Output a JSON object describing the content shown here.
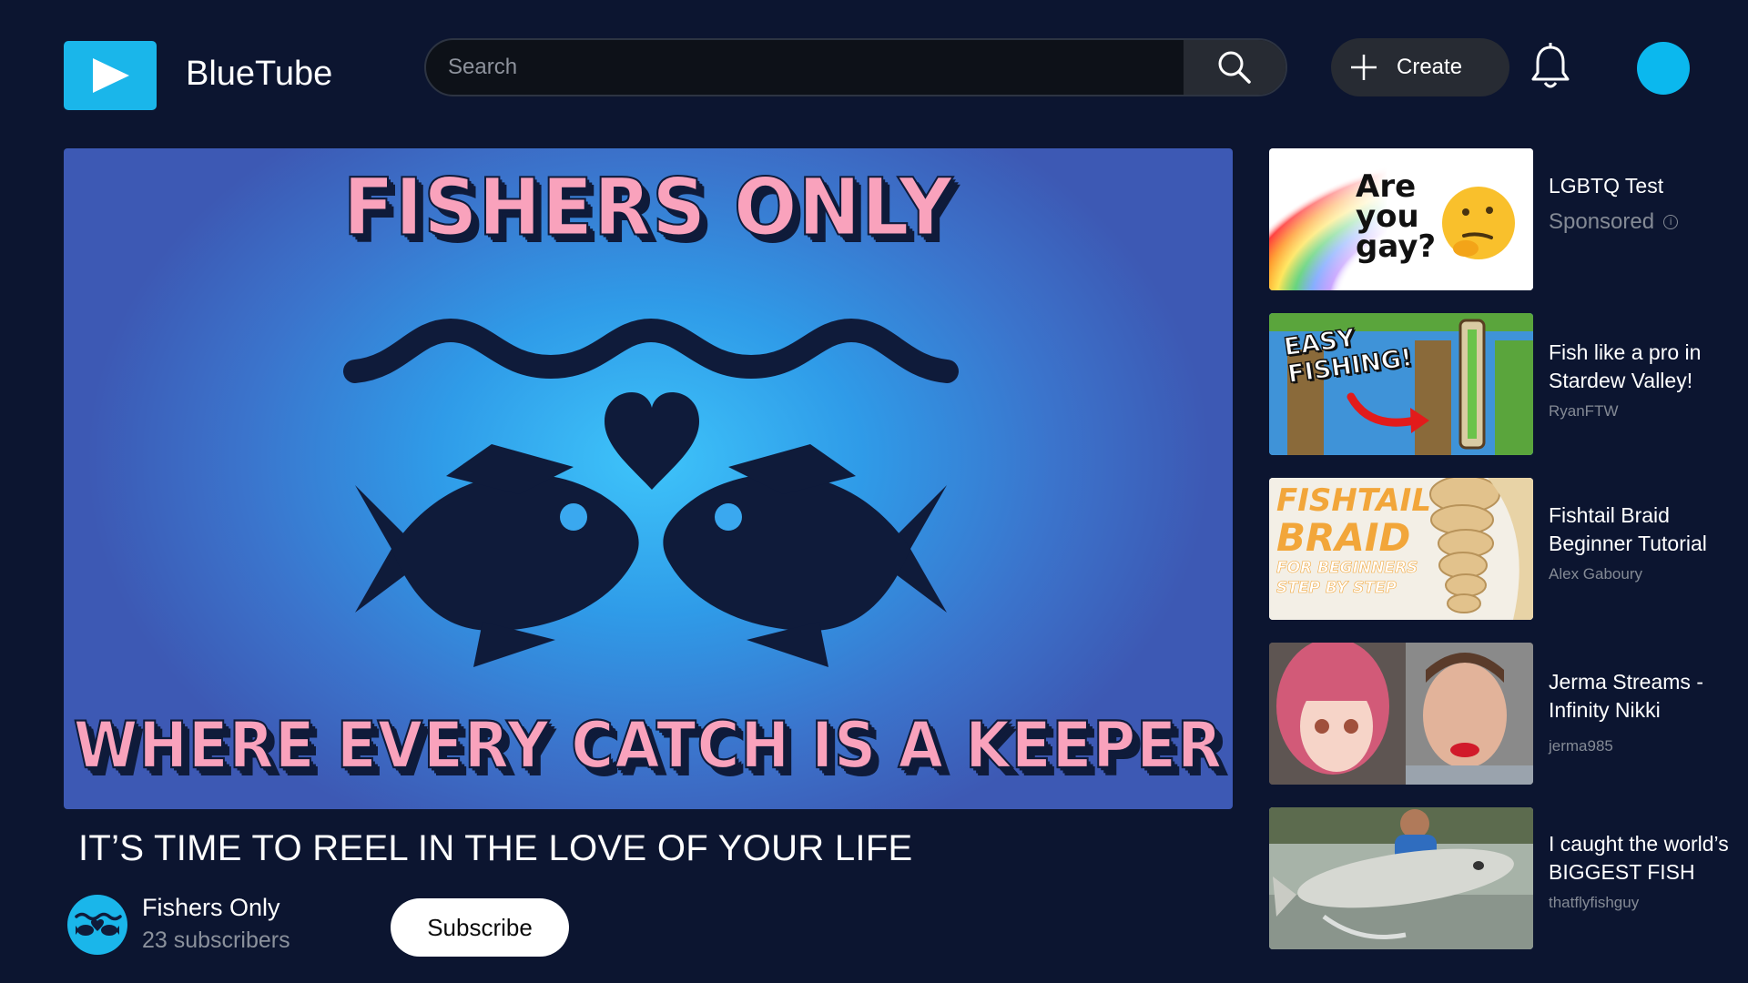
{
  "header": {
    "brand_name": "BlueTube",
    "search_placeholder": "Search",
    "create_label": "Create"
  },
  "video": {
    "thumbnail_title": "FISHERS ONLY",
    "thumbnail_subtitle": "WHERE EVERY CATCH IS A KEEPER",
    "title": "IT’S TIME TO REEL IN THE LOVE OF YOUR LIFE",
    "channel_name": "Fishers Only",
    "subscribers": "23 subscribers",
    "subscribe_label": "Subscribe"
  },
  "sidebar": {
    "items": [
      {
        "title": "LGBTQ Test",
        "channel": "Sponsored",
        "sponsored": true,
        "thumb_text": [
          "Are",
          "you",
          "gay?"
        ]
      },
      {
        "title": "Fish like a pro in Stardew Valley!",
        "channel": "RyanFTW",
        "thumb_text": [
          "EASY",
          "FISHING!"
        ]
      },
      {
        "title": "Fishtail Braid Beginner Tutorial",
        "channel": "Alex Gaboury",
        "thumb_text": [
          "FISHTAIL",
          "BRAID",
          "FOR BEGINNERS",
          "STEP BY STEP"
        ]
      },
      {
        "title": "Jerma Streams - Infinity Nikki",
        "channel": "jerma985"
      },
      {
        "title": "I caught the world’s BIGGEST FISH",
        "channel": "thatflyfishguy"
      }
    ]
  },
  "colors": {
    "background": "#0c1530",
    "accent": "#1ab6ea",
    "thumb_text": "#f9a2bc"
  }
}
